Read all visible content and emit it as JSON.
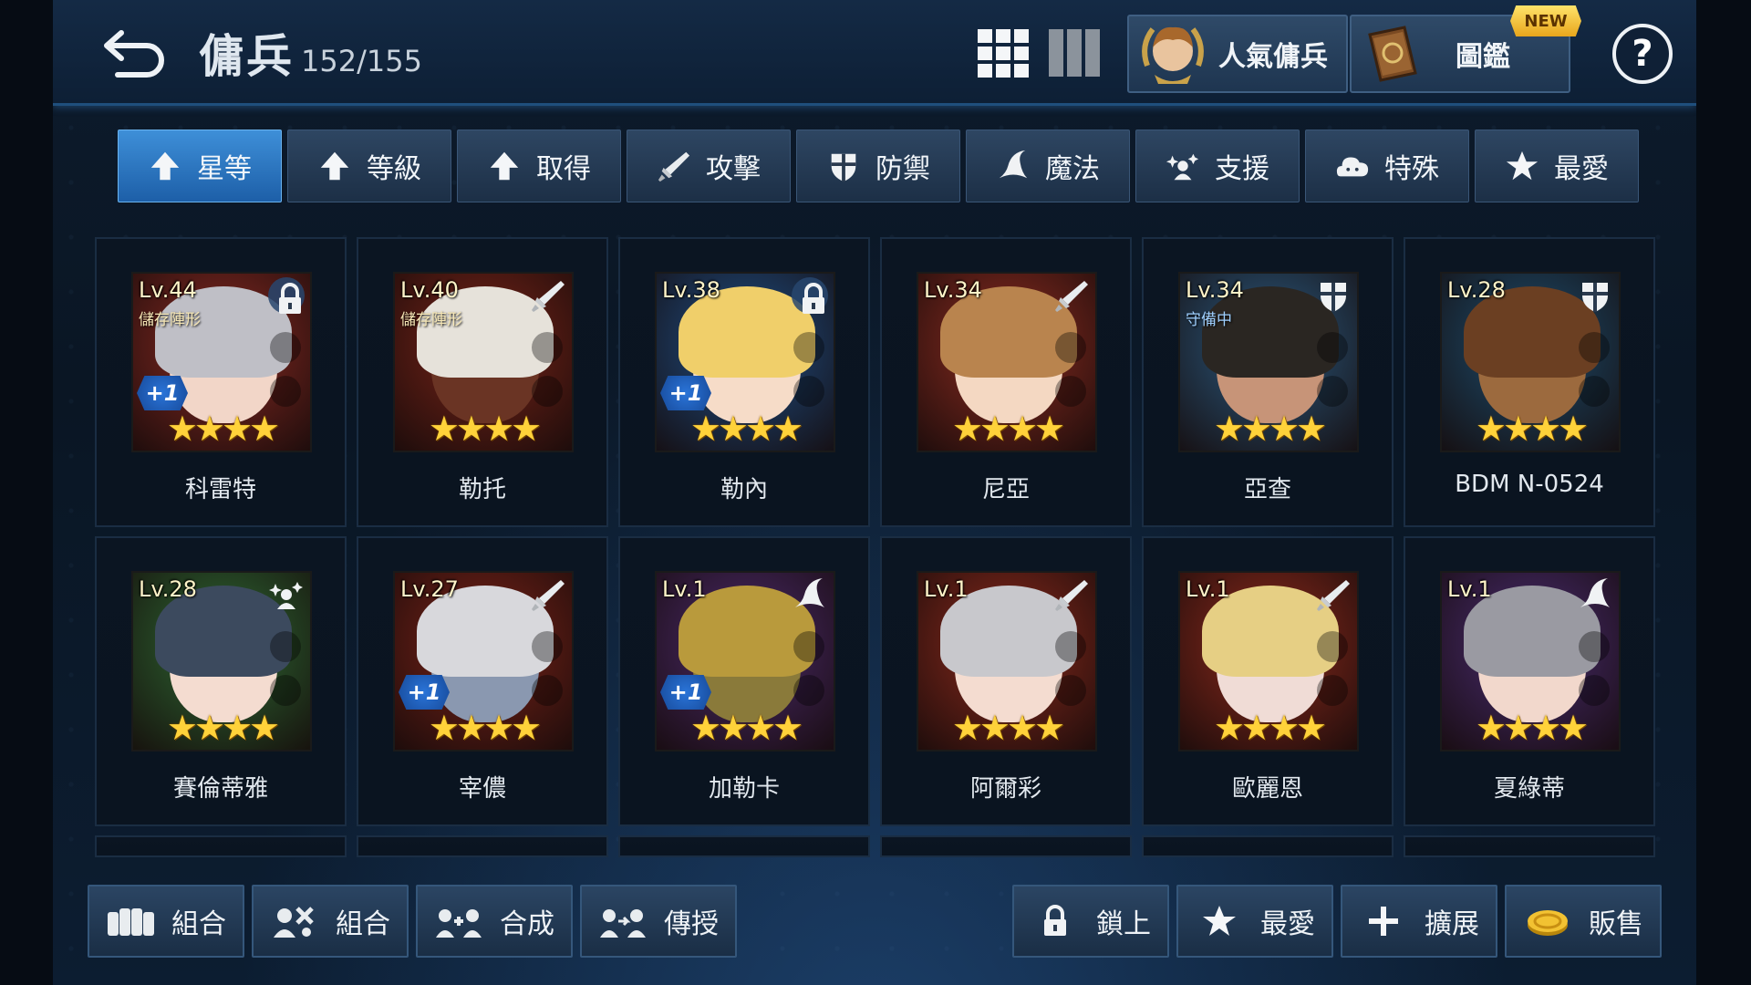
{
  "header": {
    "title": "傭兵",
    "count": "152/155",
    "popular_label": "人氣傭兵",
    "codex_label": "圖鑑",
    "new_badge": "NEW",
    "help_label": "?"
  },
  "sort_tabs": [
    {
      "label": "星等",
      "icon": "up-arrow-icon",
      "active": true
    },
    {
      "label": "等級",
      "icon": "up-arrow-icon",
      "active": false
    },
    {
      "label": "取得",
      "icon": "up-arrow-icon",
      "active": false
    },
    {
      "label": "攻擊",
      "icon": "sword-icon",
      "active": false
    },
    {
      "label": "防禦",
      "icon": "shield-icon",
      "active": false
    },
    {
      "label": "魔法",
      "icon": "magic-hat-icon",
      "active": false
    },
    {
      "label": "支援",
      "icon": "support-icon",
      "active": false
    },
    {
      "label": "特殊",
      "icon": "cloud-icon",
      "active": false
    },
    {
      "label": "最愛",
      "icon": "star-icon",
      "active": false
    }
  ],
  "heroes": [
    {
      "level": "Lv.44",
      "name": "科雷特",
      "sub": "儲存陣形",
      "plus": "+1",
      "stars": 4,
      "badge": "lock-icon",
      "bg": "#8a2a22",
      "hair": "#bfbfc6",
      "skin": "#f2d6c8"
    },
    {
      "level": "Lv.40",
      "name": "勒托",
      "sub": "儲存陣形",
      "plus": "",
      "stars": 4,
      "badge": "sword-icon",
      "bg": "#7a2418",
      "hair": "#e6e2da",
      "skin": "#6a3424"
    },
    {
      "level": "Lv.38",
      "name": "勒內",
      "sub": "",
      "plus": "+1",
      "stars": 4,
      "badge": "lock-icon",
      "bg": "#1f4f86",
      "hair": "#f0cf6a",
      "skin": "#f6dcc8"
    },
    {
      "level": "Lv.34",
      "name": "尼亞",
      "sub": "",
      "plus": "",
      "stars": 4,
      "badge": "sword-icon",
      "bg": "#8e2c20",
      "hair": "#b9844e",
      "skin": "#f4d8c2"
    },
    {
      "level": "Lv.34",
      "name": "亞查",
      "sub": "守備中",
      "plus": "",
      "stars": 4,
      "badge": "shield-icon",
      "bg": "#2b5a80",
      "hair": "#2a2622",
      "skin": "#c79478"
    },
    {
      "level": "Lv.28",
      "name": "BDM N-0524",
      "sub": "",
      "plus": "",
      "stars": 4,
      "badge": "shield-icon",
      "bg": "#1d4d6e",
      "hair": "#6b3f22",
      "skin": "#9c6a3e"
    },
    {
      "level": "Lv.28",
      "name": "賽倫蒂雅",
      "sub": "",
      "plus": "",
      "stars": 4,
      "badge": "support-icon",
      "bg": "#2f6a34",
      "hair": "#3c4a5e",
      "skin": "#f4dcd0"
    },
    {
      "level": "Lv.27",
      "name": "宰儂",
      "sub": "",
      "plus": "+1",
      "stars": 4,
      "badge": "sword-icon",
      "bg": "#7c2318",
      "hair": "#d8d8dc",
      "skin": "#8a98b0"
    },
    {
      "level": "Lv.1",
      "name": "加勒卡",
      "sub": "",
      "plus": "+1",
      "stars": 4,
      "badge": "magic-hat-icon",
      "bg": "#4c2a6a",
      "hair": "#b99a3c",
      "skin": "#8a7a3a"
    },
    {
      "level": "Lv.1",
      "name": "阿爾彩",
      "sub": "",
      "plus": "",
      "stars": 4,
      "badge": "sword-icon",
      "bg": "#8c2a1c",
      "hair": "#c8c8cc",
      "skin": "#f4dcd0"
    },
    {
      "level": "Lv.1",
      "name": "歐麗恩",
      "sub": "",
      "plus": "",
      "stars": 4,
      "badge": "sword-icon",
      "bg": "#8e2a1c",
      "hair": "#e6cf84",
      "skin": "#f0dcd6"
    },
    {
      "level": "Lv.1",
      "name": "夏綠蒂",
      "sub": "",
      "plus": "",
      "stars": 4,
      "badge": "magic-hat-icon",
      "bg": "#4a2c70",
      "hair": "#9a9aa2",
      "skin": "#f2d8cc"
    }
  ],
  "bottom_left": [
    {
      "label": "組合",
      "icon": "formation-icon"
    },
    {
      "label": "組合",
      "icon": "combo-icon"
    },
    {
      "label": "合成",
      "icon": "fusion-icon"
    },
    {
      "label": "傳授",
      "icon": "transfer-icon"
    }
  ],
  "bottom_right": [
    {
      "label": "鎖上",
      "icon": "lock-icon"
    },
    {
      "label": "最愛",
      "icon": "star-icon"
    },
    {
      "label": "擴展",
      "icon": "plus-icon"
    },
    {
      "label": "販售",
      "icon": "coin-icon"
    }
  ],
  "colors": {
    "accent": "#3e8fd8",
    "star": "#ffd23a"
  }
}
